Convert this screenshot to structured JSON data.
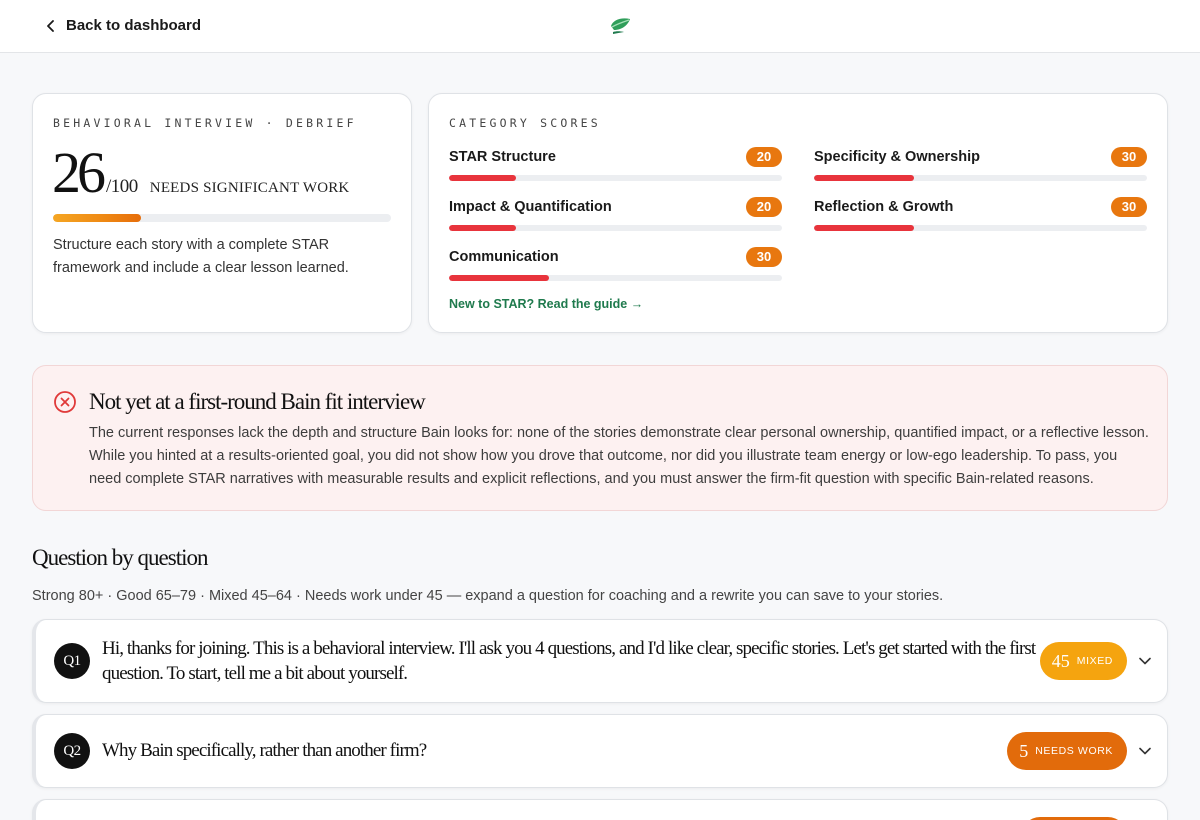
{
  "header": {
    "back_label": "Back to dashboard"
  },
  "score_card": {
    "eyebrow": "BEHAVIORAL INTERVIEW · DEBRIEF",
    "score": "26",
    "max": "/100",
    "verdict": "NEEDS SIGNIFICANT WORK",
    "progress_fraction": 0.26,
    "description": "Structure each story with a complete STAR framework and include a clear lesson learned."
  },
  "categories": {
    "eyebrow": "CATEGORY SCORES",
    "items": [
      {
        "label": "STAR Structure",
        "score": "20",
        "fraction": 0.2
      },
      {
        "label": "Specificity & Ownership",
        "score": "30",
        "fraction": 0.3
      },
      {
        "label": "Impact & Quantification",
        "score": "20",
        "fraction": 0.2
      },
      {
        "label": "Reflection & Growth",
        "score": "30",
        "fraction": 0.3
      },
      {
        "label": "Communication",
        "score": "30",
        "fraction": 0.3
      }
    ],
    "guide_link": "New to STAR? Read the guide →"
  },
  "alert": {
    "icon": "x-circle-icon",
    "title": "Not yet at a first-round Bain fit interview",
    "body": "The current responses lack the depth and structure Bain looks for: none of the stories demonstrate clear personal ownership, quantified impact, or a reflective lesson. While you hinted at a results-oriented goal, you did not show how you drove that outcome, nor did you illustrate team energy or low-ego leadership. To pass, you need complete STAR narratives with measurable results and explicit reflections, and you must answer the firm-fit question with specific Bain-related reasons."
  },
  "questions": {
    "title": "Question by question",
    "legend": "Strong 80+ · Good 65–79 · Mixed 45–64 · Needs work under 45 — expand a question for coaching and a rewrite you can save to your stories.",
    "items": [
      {
        "num": "Q1",
        "text": "Hi, thanks for joining. This is a behavioral interview. I'll ask you 4 questions, and I'd like clear, specific stories. Let's get started with the first question. To start, tell me a bit about yourself.",
        "score": "45",
        "label": "MIXED"
      },
      {
        "num": "Q2",
        "text": "Why Bain specifically, rather than another firm?",
        "score": "5",
        "label": "NEEDS WORK"
      }
    ]
  },
  "colors": {
    "accent_orange": "#e8770f",
    "mixed_orange": "#f5a40f",
    "bar_red": "#e8343c",
    "guide_green": "#1f7a4d",
    "alert_bg": "#fdf1f1",
    "alert_icon": "#e03a3a"
  }
}
